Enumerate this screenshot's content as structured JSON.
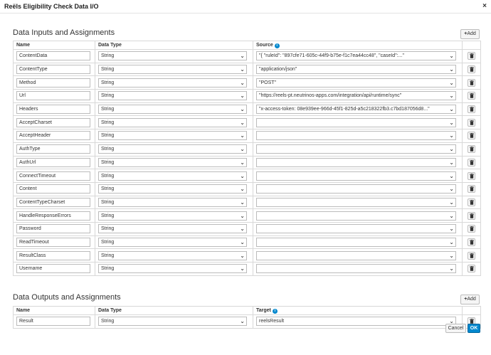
{
  "dialog": {
    "title": "Reëls Eligibility Check Data I/O",
    "close_icon": "×"
  },
  "inputs": {
    "section_title": "Data Inputs and Assignments",
    "add_label": "Add",
    "columns": {
      "name": "Name",
      "type": "Data Type",
      "source": "Source"
    },
    "rows": [
      {
        "name": "ContentData",
        "type": "String",
        "source": "\"{ \"ruleId\": \"897cfe71-605c-44f9-b75e-f1c7ea44cc48\", \"caseId\":...\""
      },
      {
        "name": "ContentType",
        "type": "String",
        "source": "\"application/json\""
      },
      {
        "name": "Method",
        "type": "String",
        "source": "\"POST\""
      },
      {
        "name": "Url",
        "type": "String",
        "source": "\"https://reels-pt.neutrinos-apps.com/integration/api/runtime/sync\""
      },
      {
        "name": "Headers",
        "type": "String",
        "source": "\"x-access-token: 08e939ee-966d-45f1-825d-a5c218322fb3.c7bd187056d8...\""
      },
      {
        "name": "AcceptCharset",
        "type": "String",
        "source": ""
      },
      {
        "name": "AcceptHeader",
        "type": "String",
        "source": ""
      },
      {
        "name": "AuthType",
        "type": "String",
        "source": ""
      },
      {
        "name": "AuthUrl",
        "type": "String",
        "source": ""
      },
      {
        "name": "ConnectTimeout",
        "type": "String",
        "source": ""
      },
      {
        "name": "Content",
        "type": "String",
        "source": ""
      },
      {
        "name": "ContentTypeCharset",
        "type": "String",
        "source": ""
      },
      {
        "name": "HandleResponseErrors",
        "type": "String",
        "source": ""
      },
      {
        "name": "Password",
        "type": "String",
        "source": ""
      },
      {
        "name": "ReadTimeout",
        "type": "String",
        "source": ""
      },
      {
        "name": "ResultClass",
        "type": "String",
        "source": ""
      },
      {
        "name": "Username",
        "type": "String",
        "source": ""
      }
    ]
  },
  "outputs": {
    "section_title": "Data Outputs and Assignments",
    "add_label": "Add",
    "columns": {
      "name": "Name",
      "type": "Data Type",
      "target": "Target"
    },
    "rows": [
      {
        "name": "Result",
        "type": "String",
        "target": "reelsResult"
      }
    ]
  },
  "footer": {
    "cancel_label": "Cancel",
    "ok_label": "OK"
  },
  "icons": {
    "trash": "trash-icon",
    "info": "info-icon",
    "chevron": "chevron-down-icon",
    "close": "close-icon",
    "plus": "plus-icon"
  },
  "colors": {
    "primary": "#0088ce",
    "border": "#d8d8d8"
  }
}
